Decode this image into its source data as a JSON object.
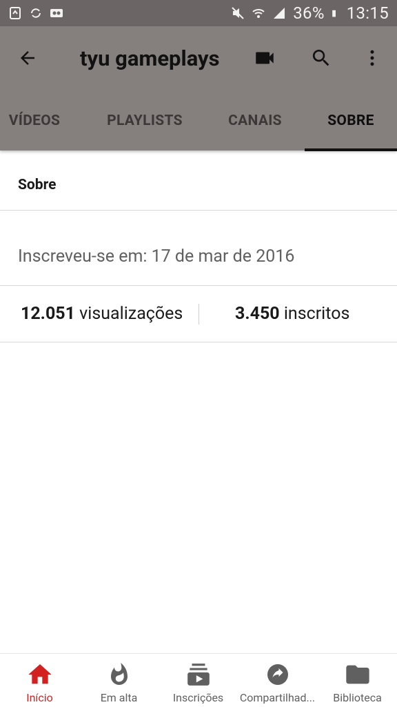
{
  "status_bar": {
    "battery": "36%",
    "time": "13:15",
    "icons": [
      "recycle-icon",
      "sync-icon",
      "voicemail-icon",
      "mute-icon",
      "wifi-icon",
      "signal-icon",
      "battery-icon"
    ]
  },
  "header": {
    "title": "tyu gameplays",
    "tabs": [
      {
        "label": "VÍDEOS"
      },
      {
        "label": "PLAYLISTS"
      },
      {
        "label": "CANAIS"
      },
      {
        "label": "SOBRE"
      }
    ],
    "active_tab": "SOBRE"
  },
  "about": {
    "heading": "Sobre",
    "joined": "Inscreveu-se em: 17 de mar de 2016",
    "views_count": "12.051",
    "views_label": "visualizações",
    "subs_count": "3.450",
    "subs_label": "inscritos"
  },
  "bottom_nav": {
    "items": [
      {
        "label": "Início",
        "icon": "home-icon"
      },
      {
        "label": "Em alta",
        "icon": "trending-icon"
      },
      {
        "label": "Inscrições",
        "icon": "subscriptions-icon"
      },
      {
        "label": "Compartilhad...",
        "icon": "share-icon"
      },
      {
        "label": "Biblioteca",
        "icon": "library-icon"
      }
    ],
    "active": "Início"
  },
  "colors": {
    "header_bg": "#857f7e",
    "status_bg": "#6b6665",
    "accent_red": "#d32121"
  }
}
